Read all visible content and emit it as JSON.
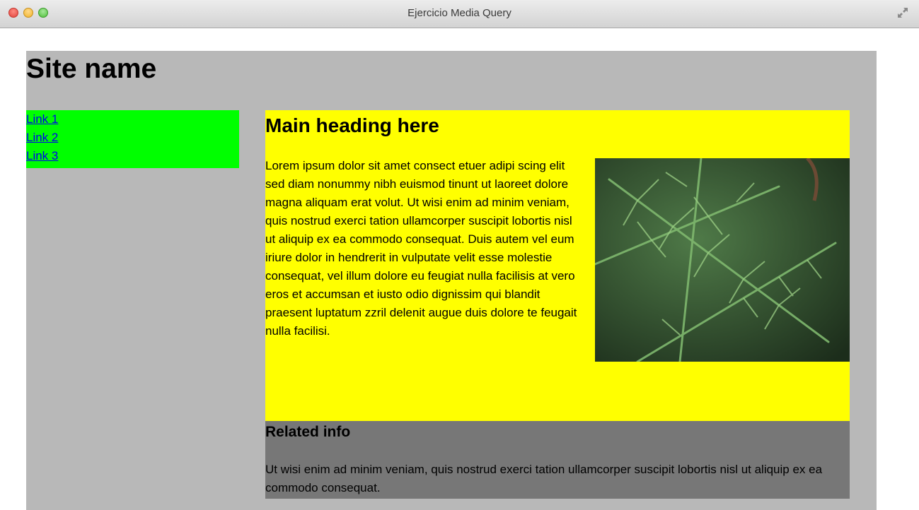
{
  "window": {
    "title": "Ejercicio Media Query"
  },
  "header": {
    "site_name": "Site name"
  },
  "nav": {
    "links": [
      "Link 1",
      "Link 2",
      "Link 3"
    ]
  },
  "main": {
    "heading": "Main heading here",
    "body": "Lorem ipsum dolor sit amet consect etuer adipi scing elit sed diam nonummy nibh euismod tinunt ut laoreet dolore magna aliquam erat volut. Ut wisi enim ad minim veniam, quis nostrud exerci tation ullamcorper suscipit lobortis nisl ut aliquip ex ea commodo consequat. Duis autem vel eum iriure dolor in hendrerit in vulputate velit esse molestie consequat, vel illum dolore eu feugiat nulla facilisis at vero eros et accumsan et iusto odio dignissim qui blandit praesent luptatum zzril delenit augue duis dolore te feugait nulla facilisi."
  },
  "related": {
    "heading": "Related info",
    "body": "Ut wisi enim ad minim veniam, quis nostrud exerci tation ullamcorper suscipit lobortis nisl ut aliquip ex ea commodo consequat."
  },
  "colors": {
    "page_bg": "#b8b8b8",
    "nav_bg": "#00ff00",
    "main_bg": "#ffff00",
    "related_bg": "#777777",
    "link": "#0000ee"
  }
}
